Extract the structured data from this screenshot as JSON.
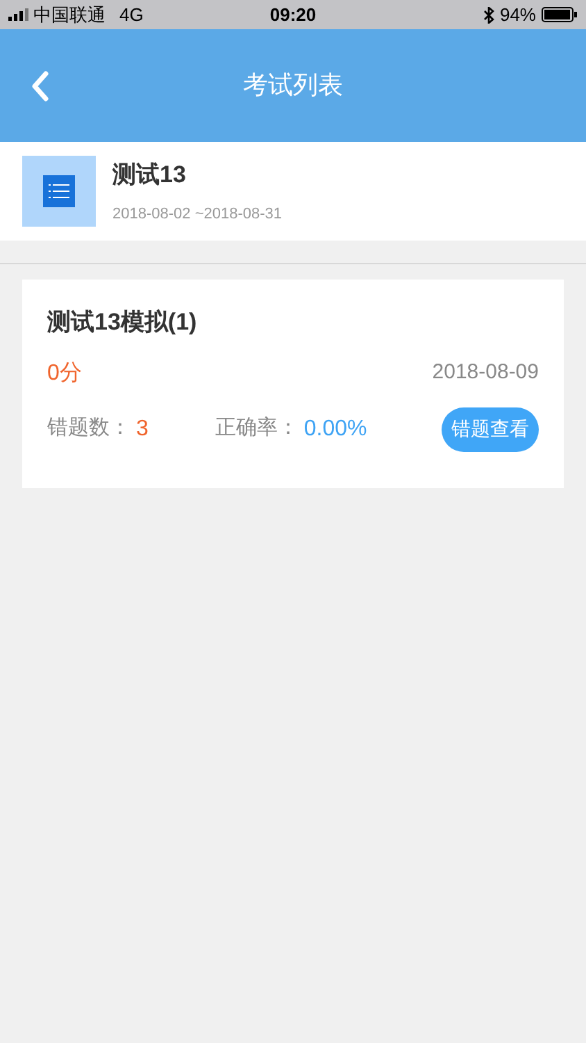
{
  "status_bar": {
    "carrier": "中国联通",
    "network": "4G",
    "time": "09:20",
    "battery": "94%"
  },
  "header": {
    "title": "考试列表"
  },
  "exam": {
    "name": "测试13",
    "period": "2018-08-02 ~2018-08-31"
  },
  "records": [
    {
      "title": "测试13模拟(1)",
      "score": "0分",
      "date": "2018-08-09",
      "wrong_label": "错题数：",
      "wrong_count": "3",
      "accuracy_label": "正确率：",
      "accuracy": "0.00%",
      "button": "错题查看"
    }
  ]
}
